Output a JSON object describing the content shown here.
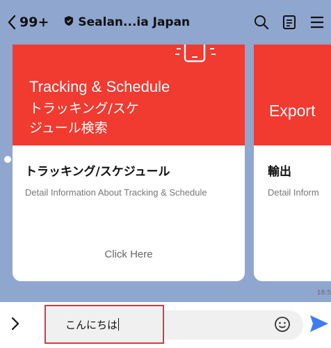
{
  "header": {
    "back_count": "99+",
    "chat_name": "Sealan...ia Japan"
  },
  "cards": [
    {
      "banner_en": "Tracking & Schedule",
      "banner_jp_line1": "トラッキング/スケ",
      "banner_jp_line2": "ジュール検索",
      "title": "トラッキング/スケジュール",
      "description": "Detail Information About Tracking & Schedule",
      "action": "Click Here"
    },
    {
      "banner_en": "Export",
      "title": "輸出",
      "description": "Detail Inform"
    }
  ],
  "timestamp": "18:5",
  "input": {
    "value": "こんにちは"
  },
  "colors": {
    "header_bg": "#8fa6cf",
    "banner_red": "#f13a30",
    "send_blue": "#3f7cf2",
    "highlight_border": "#d93a3a"
  },
  "icons": [
    "chevron-left-icon",
    "shield-icon",
    "search-icon",
    "notes-icon",
    "menu-icon",
    "chevron-right-icon",
    "emoji-icon",
    "send-icon",
    "phone-icon"
  ]
}
